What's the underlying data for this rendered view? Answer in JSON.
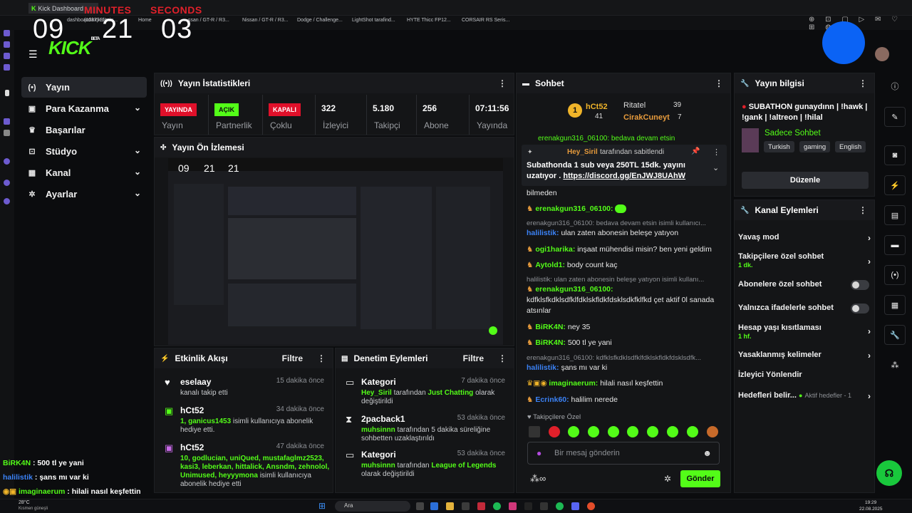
{
  "overlay": {
    "minutes_label": "MINUTES",
    "seconds_label": "SECONDS",
    "hours": "09",
    "minutes": "21",
    "seconds": "03"
  },
  "browser": {
    "active_tab": "Kick Dashboard",
    "tab_second": "Twitter",
    "address": "dashboard.kick.com",
    "bookmarks": [
      "(1087) Elimin...",
      "Home",
      "HSB...",
      "...ssan / GT-R / R3...",
      "Nissan / GT-R / R3...",
      "Dodge / Challenge...",
      "LightShot tarafind...",
      "HYTE Thicc FP12...",
      "CORSAIR RS Seris..."
    ]
  },
  "brand": {
    "logo": "KICK",
    "beta": "BETA",
    "accent": "#53fc18"
  },
  "nav": [
    {
      "label": "Yayın",
      "icon": "broadcast-icon"
    },
    {
      "label": "Para Kazanma",
      "icon": "money-icon"
    },
    {
      "label": "Başarılar",
      "icon": "trophy-icon"
    },
    {
      "label": "Stüdyo",
      "icon": "studio-icon"
    },
    {
      "label": "Kanal",
      "icon": "channel-icon"
    },
    {
      "label": "Ayarlar",
      "icon": "gear-icon"
    }
  ],
  "stats": {
    "title": "Yayın İstatistikleri",
    "items": [
      {
        "value": "YAYINDA",
        "label": "Yayın"
      },
      {
        "value": "AÇIK",
        "label": "Partnerlik"
      },
      {
        "value": "KAPALI",
        "label": "Çoklu"
      },
      {
        "value": "322",
        "label": "İzleyici"
      },
      {
        "value": "5.180",
        "label": "Takipçi"
      },
      {
        "value": "256",
        "label": "Abone"
      },
      {
        "value": "07:11:56",
        "label": "Yayında"
      }
    ]
  },
  "preview": {
    "title": "Yayın Ön İzlemesi",
    "mini_time": [
      "09",
      "21",
      "21"
    ]
  },
  "activity": {
    "title": "Etkinlik Akışı",
    "filter": "Filtre",
    "items": [
      {
        "name": "eselaay",
        "time": "15 dakika önce",
        "desc": "kanalı takip etti",
        "icon": "heart-icon"
      },
      {
        "name": "hCt52",
        "time": "34 dakika önce",
        "desc_hl": "1, ganicus1453",
        "desc": " isimli kullanıcıya abonelik hediye etti.",
        "icon": "gift-icon"
      },
      {
        "name": "hCt52",
        "time": "47 dakika önce",
        "desc_hl": "10, godlucian, uniQued, mustafaglmz2523, kasi3, leberkan, hittalick, Ansndm, zehnolol, Unimused, heyyymona",
        "desc": "isimli kullanıcıya abonelik hediye etti",
        "icon": "gift-icon"
      }
    ]
  },
  "mod": {
    "title": "Denetim Eylemleri",
    "filter": "Filtre",
    "items": [
      {
        "name": "Kategori",
        "time": "7 dakika önce",
        "u": "Hey_Siril",
        "mid": " tarafından ",
        "hl": "Just Chatting",
        "end": " olarak değiştirildi",
        "icon": "category-icon"
      },
      {
        "name": "2pacback1",
        "time": "53 dakika önce",
        "u": "muhsinnn",
        "mid": " tarafından 5 dakika süreliğine sohbetten uzaklaştırıldı",
        "hl": "",
        "end": "",
        "icon": "hourglass-icon"
      },
      {
        "name": "Kategori",
        "time": "53 dakika önce",
        "u": "muhsinnn",
        "mid": " tarafından ",
        "hl": "League of Legends",
        "end": " olarak değiştirildi",
        "icon": "category-icon"
      }
    ]
  },
  "chat": {
    "title": "Sohbet",
    "top": [
      {
        "rank": "1",
        "name": "hCt52",
        "count": "41"
      },
      {
        "name": "Ritatel",
        "count": "39"
      },
      {
        "name": "CirakCuneyt",
        "count": "7"
      }
    ],
    "pinned": {
      "by_user": "Hey_Siril",
      "by_text": "tarafından sabitlendi",
      "text": "Subathonda 1 sub veya 250TL 15dk. yayını uzatıyor . ",
      "link": "https://discord.gg/EnJWJ8UAhW"
    },
    "cutoff": "erenakgun316_06100: bedava devam etsin",
    "lines": [
      {
        "type": "text",
        "text": "bilmeden"
      },
      {
        "type": "msg",
        "user": "erenakgun316_06100:",
        "color": "#53fc18",
        "text": ""
      },
      {
        "type": "reply",
        "text": "erenakgun316_06100: bedava devam etsin isimli kullanıcı..."
      },
      {
        "type": "msg",
        "user": "halilistik:",
        "color": "#3b82f6",
        "text": "ulan zaten abonesin beleşe yatıyon"
      },
      {
        "type": "msg",
        "user": "ogi1harika:",
        "color": "#53fc18",
        "text": "inşaat mühendisi misin? ben yeni geldim"
      },
      {
        "type": "msg",
        "user": "Aytold1:",
        "color": "#53fc18",
        "text": "body count kaç"
      },
      {
        "type": "reply",
        "text": "halilistik: ulan zaten abonesin beleşe yatıyon isimli kullanı..."
      },
      {
        "type": "msg",
        "user": "erenakgun316_06100:",
        "color": "#53fc18",
        "text": ""
      },
      {
        "type": "text",
        "text": "kdfklsfkdklsdfklfdklskfldkfdsklsdkfklfkd çet aktif 0l sanada"
      },
      {
        "type": "text",
        "text": "atsınlar"
      },
      {
        "type": "msg",
        "user": "BiRK4N:",
        "color": "#53fc18",
        "text": "ney 35"
      },
      {
        "type": "msg",
        "user": "BiRK4N:",
        "color": "#53fc18",
        "text": "500 tl ye yani"
      },
      {
        "type": "reply",
        "text": "erenakgun316_06100: kdfklsfkdklsdfklfdklskfldkfdsklsdfk..."
      },
      {
        "type": "msg",
        "user": "halilistik:",
        "color": "#3b82f6",
        "text": "şans mı var ki"
      },
      {
        "type": "msg",
        "user": "imaginaerum:",
        "color": "#53fc18",
        "text": "hilali nasıl keşfettin"
      },
      {
        "type": "msg",
        "user": "Ecrink60:",
        "color": "#3b82f6",
        "text": "halilim nerede"
      }
    ],
    "followers_only": "Takipçilere Özel",
    "placeholder": "Bir mesaj gönderin",
    "send": "Gönder"
  },
  "info": {
    "title": "Yayın bilgisi",
    "stream_title": "SUBATHON gunaydınn | !hawk | !gank | !altreon | !hilal",
    "category": "Sadece Sohbet",
    "tags": [
      "Turkish",
      "gaming",
      "English"
    ],
    "edit": "Düzenle"
  },
  "channel_actions": {
    "title": "Kanal Eylemleri",
    "items": [
      {
        "label": "Yavaş mod",
        "kind": "arrow",
        "sub": ""
      },
      {
        "label": "Takipçilere özel sohbet",
        "kind": "arrow",
        "sub": "1 dk."
      },
      {
        "label": "Abonelere özel sohbet",
        "kind": "toggle",
        "sub": ""
      },
      {
        "label": "Yalnızca ifadelerle sohbet",
        "kind": "toggle",
        "sub": ""
      },
      {
        "label": "Hesap yaşı kısıtlaması",
        "kind": "arrow",
        "sub": "1 hf."
      },
      {
        "label": "Yasaklanmış kelimeler",
        "kind": "arrow",
        "sub": ""
      },
      {
        "label": "İzleyici Yönlendir",
        "kind": "none",
        "sub": ""
      },
      {
        "label": "Hedefleri belir...",
        "kind": "arrow",
        "sub": "",
        "extra": "Aktif hedefler - 1"
      }
    ]
  },
  "overlay_chat": [
    {
      "user": "BiRK4N",
      "text": " : 500 tl ye yani"
    },
    {
      "user": "halilistik",
      "text": " : şans mı var ki"
    },
    {
      "user": "imaginaerum",
      "text": " : hilali nasıl keşfettin"
    }
  ],
  "taskbar": {
    "weather": "28°C",
    "weather_sub": "Kısmen güneşli",
    "search": "Ara",
    "time": "19:29",
    "date": "22.08.2025"
  }
}
